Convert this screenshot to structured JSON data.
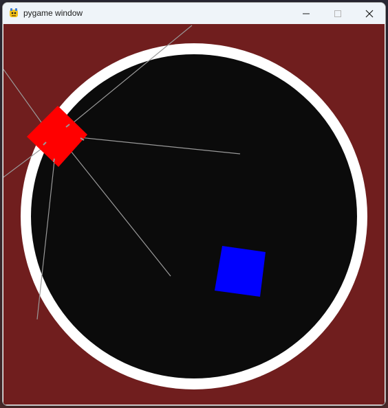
{
  "window": {
    "title": "pygame window",
    "app_icon": "pygame-snake-icon",
    "controls": {
      "minimize_icon": "minimize-icon",
      "maximize_icon": "maximize-icon",
      "close_icon": "close-icon"
    }
  },
  "scene": {
    "colors": {
      "background": "#701e1e",
      "arena_ring": "#ffffff",
      "arena_floor": "#0b0b0b",
      "player_square": "#ff0000",
      "target_square": "#0000ff",
      "rays": "#9a9a9a"
    }
  }
}
